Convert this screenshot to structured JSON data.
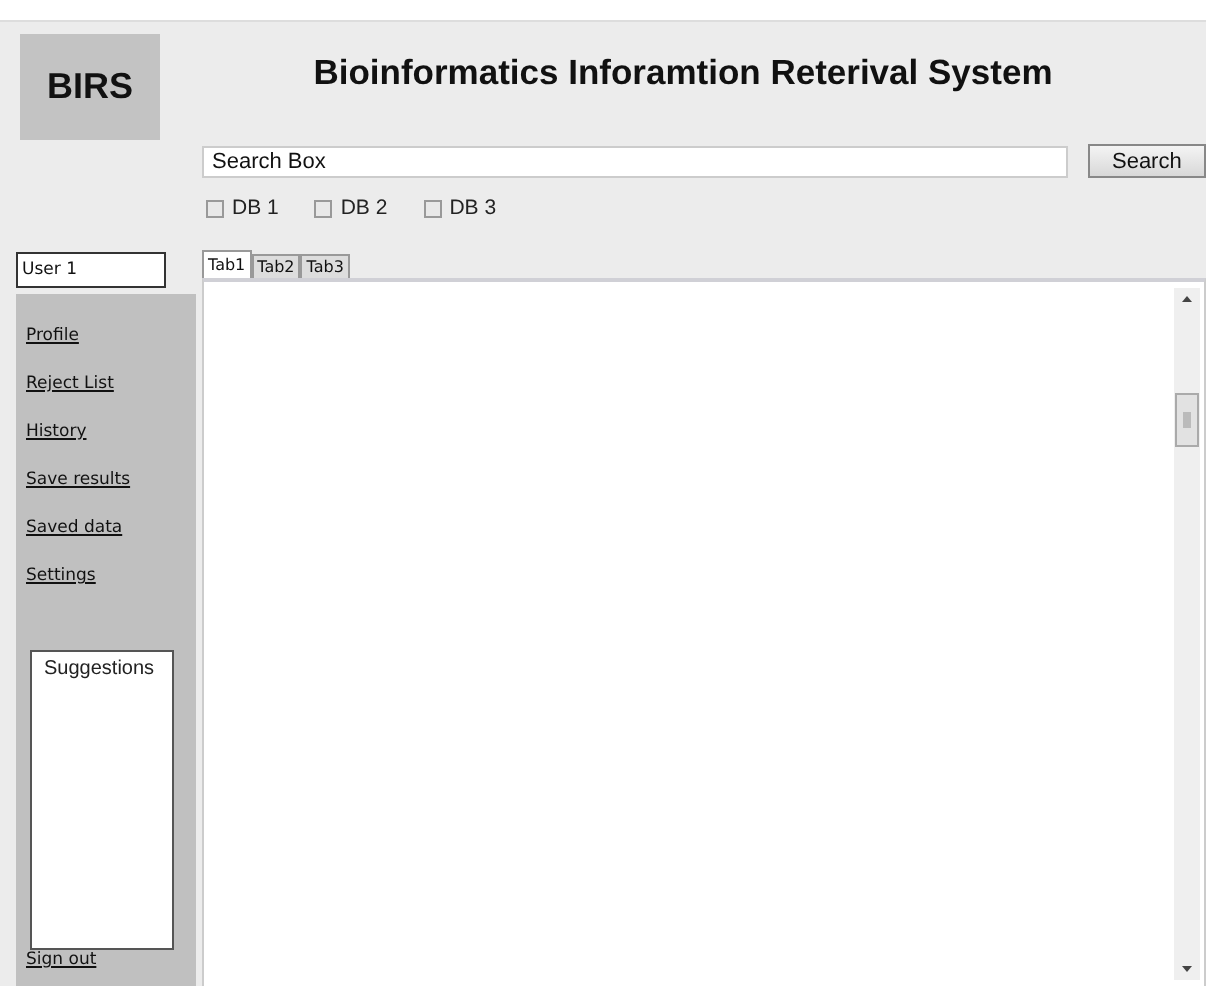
{
  "logo": {
    "text": "BIRS"
  },
  "title": "Bioinformatics Inforamtion Reterival System",
  "search": {
    "value": "Search Box",
    "button": "Search"
  },
  "databases": [
    {
      "label": "DB 1",
      "checked": false
    },
    {
      "label": "DB 2",
      "checked": false
    },
    {
      "label": "DB 3",
      "checked": false
    }
  ],
  "user": {
    "value": "User 1"
  },
  "sidebar": {
    "items": [
      "Profile",
      "Reject List",
      "History",
      "Save results",
      "Saved data",
      "Settings"
    ],
    "suggestions": "Suggestions",
    "sign_out": "Sign out"
  },
  "tabs": [
    {
      "label": "Tab1",
      "selected": true
    },
    {
      "label": "Tab2",
      "selected": false
    },
    {
      "label": "Tab3",
      "selected": false
    }
  ]
}
